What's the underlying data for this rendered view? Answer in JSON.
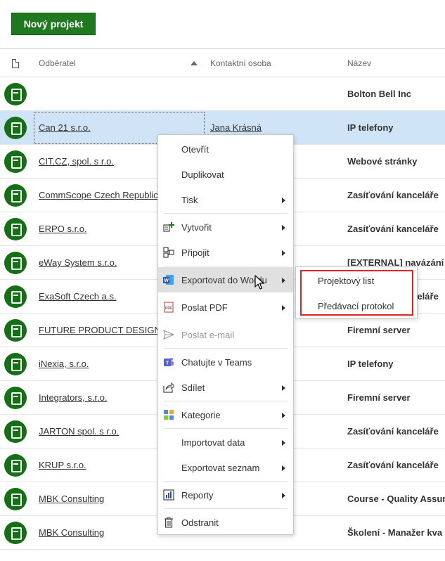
{
  "toolbar": {
    "new_project_label": "Nový projekt"
  },
  "table": {
    "columns": {
      "customer": "Odběratel",
      "contact": "Kontaktní osoba",
      "name": "Název"
    },
    "sort": {
      "column": "customer",
      "direction": "ascending"
    },
    "rows": [
      {
        "customer": "",
        "contact": "",
        "name": "Bolton Bell Inc"
      },
      {
        "customer": "Can 21 s.r.o.",
        "contact": "Jana Krásná",
        "name": "IP telefony"
      },
      {
        "customer": "CIT.CZ, spol. s r.o.",
        "contact": "",
        "name": "Webové stránky"
      },
      {
        "customer": "CommScope Czech Republic",
        "contact": "",
        "name": "Zasíťování kanceláře"
      },
      {
        "customer": "ERPO s.r.o.",
        "contact": "",
        "name": "Zasíťování kanceláře"
      },
      {
        "customer": "eWay System s.r.o.",
        "contact": "",
        "name": "[EXTERNAL] navázání"
      },
      {
        "customer": "ExaSoft Czech a.s.",
        "contact": "",
        "name": "Zasíťování kanceláře"
      },
      {
        "customer": "FUTURE PRODUCT DESIGN",
        "contact": "",
        "name": "Firemní server"
      },
      {
        "customer": "iNexia, s.r.o.",
        "contact": "",
        "name": "IP telefony"
      },
      {
        "customer": "Integrators, s.r.o.",
        "contact": "",
        "name": "Firemní server"
      },
      {
        "customer": "JARTON spol. s r.o.",
        "contact": "",
        "name": "Zasíťování kanceláře"
      },
      {
        "customer": "KRUP s.r.o.",
        "contact": "",
        "name": "Zasíťování kanceláře"
      },
      {
        "customer": "MBK Consulting",
        "contact": "",
        "name": "Course - Quality Assur"
      },
      {
        "customer": "MBK Consulting",
        "contact": "",
        "name": "Školení - Manažer kva"
      }
    ]
  },
  "context_menu": {
    "items": [
      {
        "label": "Otevřít",
        "icon": "none",
        "submenu": false
      },
      {
        "label": "Duplikovat",
        "icon": "none",
        "submenu": false
      },
      {
        "label": "Tisk",
        "icon": "none",
        "submenu": true
      },
      {
        "label": "Vytvořit",
        "icon": "create-icon",
        "submenu": true
      },
      {
        "label": "Připojit",
        "icon": "attach-icon",
        "submenu": true
      },
      {
        "label": "Exportovat do Wordu",
        "icon": "word-icon",
        "submenu": true,
        "highlighted": true
      },
      {
        "label": "Poslat PDF",
        "icon": "pdf-icon",
        "submenu": true
      },
      {
        "label": "Poslat e-mail",
        "icon": "send-icon",
        "submenu": false,
        "disabled": true
      },
      {
        "label": "Chatujte v Teams",
        "icon": "teams-icon",
        "submenu": false
      },
      {
        "label": "Sdílet",
        "icon": "share-icon",
        "submenu": true
      },
      {
        "label": "Kategorie",
        "icon": "category-icon",
        "submenu": true
      },
      {
        "label": "Importovat data",
        "icon": "none",
        "submenu": true
      },
      {
        "label": "Exportovat seznam",
        "icon": "none",
        "submenu": true
      },
      {
        "label": "Reporty",
        "icon": "report-icon",
        "submenu": true
      },
      {
        "label": "Odstranit",
        "icon": "trash-icon",
        "submenu": false
      }
    ]
  },
  "submenu": {
    "items": [
      {
        "label": "Projektový list"
      },
      {
        "label": "Předávací protokol"
      }
    ]
  },
  "colors": {
    "brand_green": "#1f7a1f",
    "selected_row": "#cfe5f7",
    "highlight_border": "#d9262b",
    "word_blue": "#2b579a",
    "teams_purple": "#5b5fc7"
  }
}
